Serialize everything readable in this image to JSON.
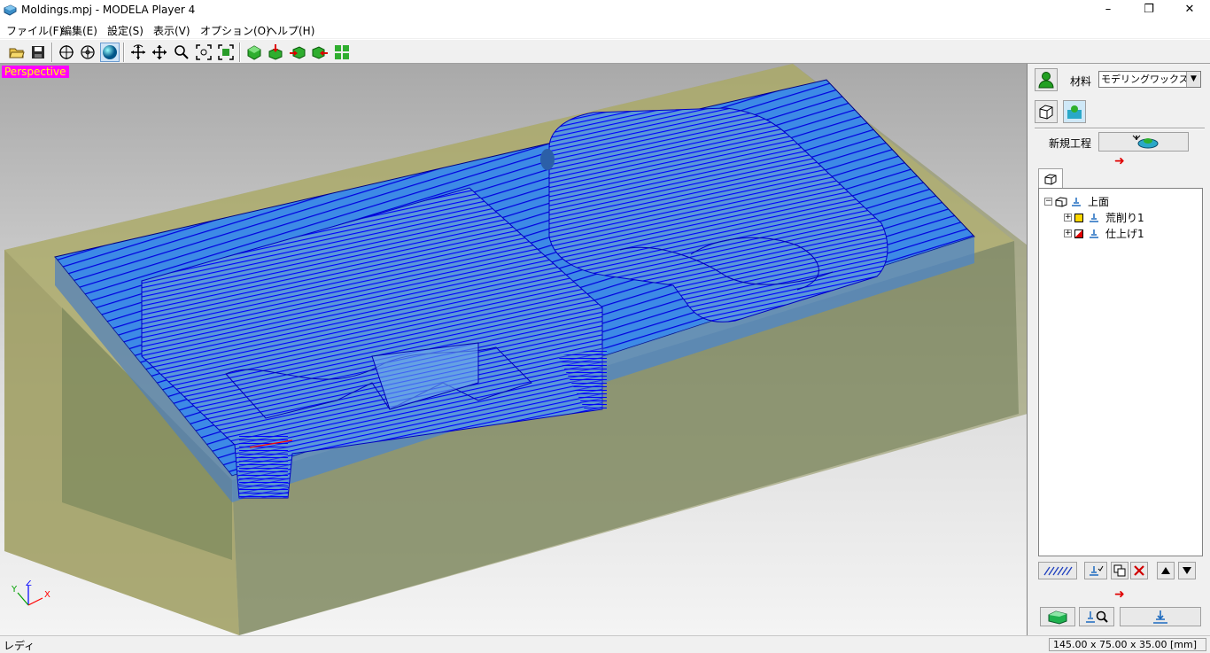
{
  "window": {
    "title": "Moldings.mpj - MODELA Player 4",
    "minimize": "–",
    "maximize": "❐",
    "close": "✕"
  },
  "menu": [
    "ファイル(F)",
    "編集(E)",
    "設定(S)",
    "表示(V)",
    "オプション(O)",
    "ヘルプ(H)"
  ],
  "viewport": {
    "label": "Perspective",
    "axes": {
      "x": "X",
      "y": "Y",
      "z": "Z"
    }
  },
  "side_panel": {
    "material_label": "材料",
    "material_value": "モデリングワックス",
    "new_process_label": "新規工程",
    "tree": {
      "root": "上面",
      "items": [
        "荒削り1",
        "仕上げ1"
      ]
    }
  },
  "status": {
    "text": "レディ",
    "dimensions": "145.00 x 75.00 x 35.00 [mm]"
  },
  "colors": {
    "stock": "#8c8f57",
    "surface": "#4a90e2",
    "toolpath": "#0000ff",
    "view_label_bg": "#ff00ff",
    "view_label_fg": "#ffff00"
  }
}
